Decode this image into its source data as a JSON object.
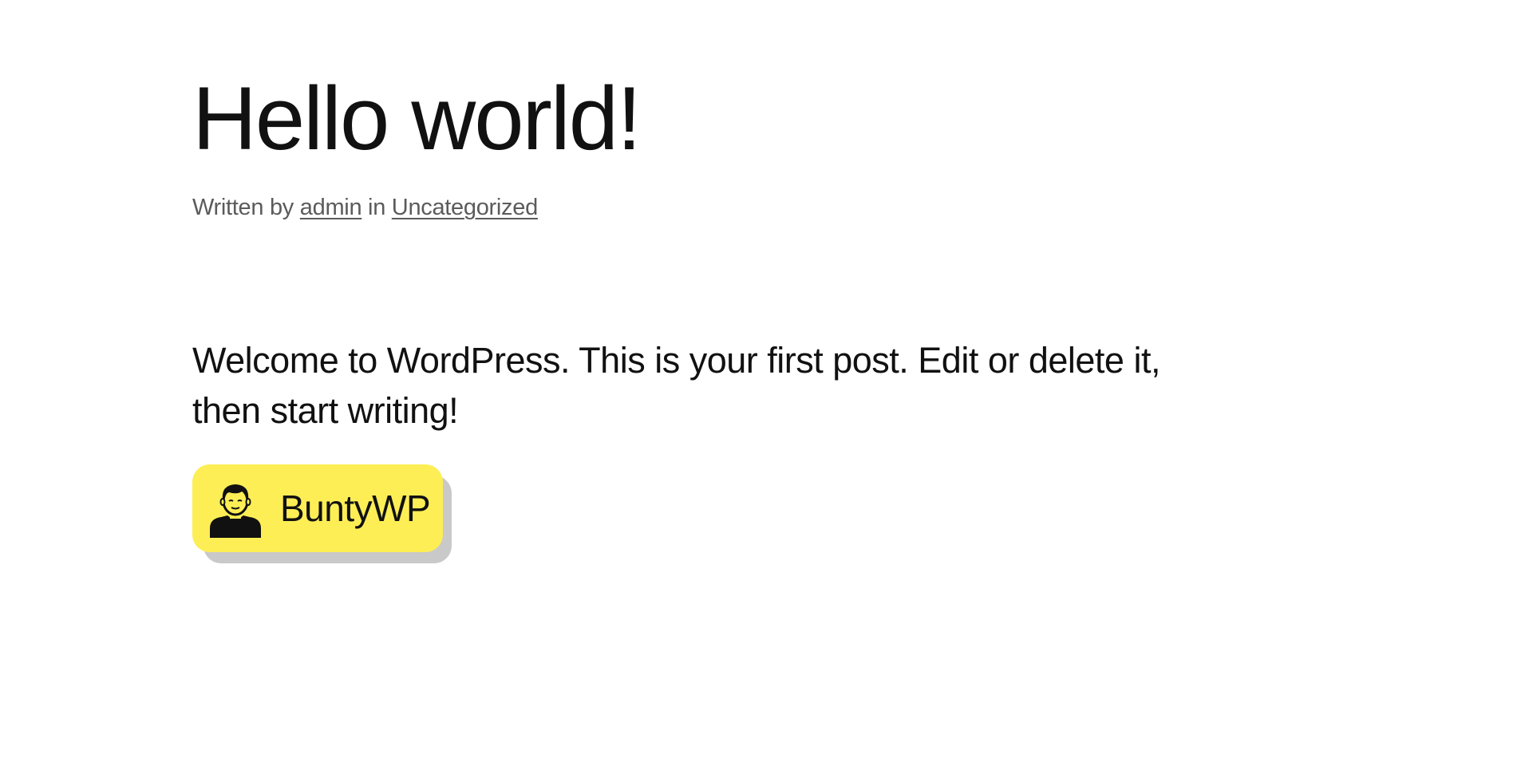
{
  "post": {
    "title": "Hello world!",
    "meta": {
      "prefix": "Written by",
      "author": "admin",
      "separator": "in",
      "category": "Uncategorized"
    },
    "body": "Welcome to WordPress. This is your first post. Edit or delete it, then start writing!"
  },
  "badge": {
    "label": "BuntyWP",
    "icon": "person-avatar-icon",
    "background_color": "#fdee55",
    "shadow_color": "#c9c9c9"
  }
}
